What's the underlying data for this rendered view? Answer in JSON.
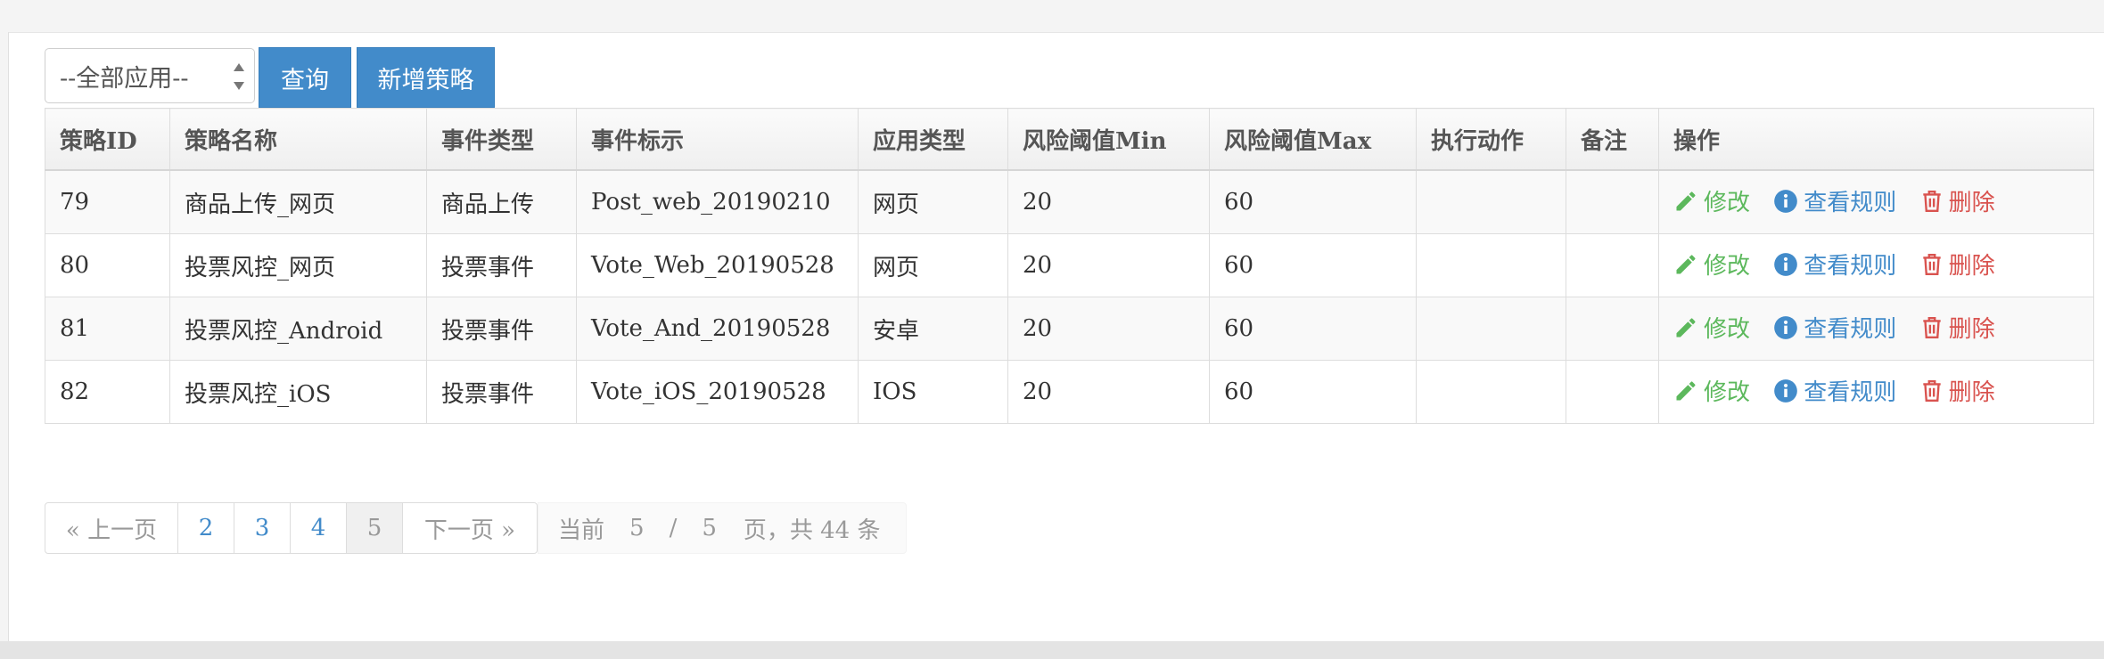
{
  "filter": {
    "app_select_value": "--全部应用--",
    "query_label": "查询",
    "add_label": "新增策略"
  },
  "table": {
    "headers": [
      "策略ID",
      "策略名称",
      "事件类型",
      "事件标示",
      "应用类型",
      "风险阈值Min",
      "风险阈值Max",
      "执行动作",
      "备注",
      "操作"
    ],
    "rows": [
      {
        "id": "79",
        "name": "商品上传_网页",
        "event_type": "商品上传",
        "event_mark": "Post_web_20190210",
        "app_type": "网页",
        "min": "20",
        "max": "60",
        "action": "",
        "remark": ""
      },
      {
        "id": "80",
        "name": "投票风控_网页",
        "event_type": "投票事件",
        "event_mark": "Vote_Web_20190528",
        "app_type": "网页",
        "min": "20",
        "max": "60",
        "action": "",
        "remark": ""
      },
      {
        "id": "81",
        "name": "投票风控_Android",
        "event_type": "投票事件",
        "event_mark": "Vote_And_20190528",
        "app_type": "安卓",
        "min": "20",
        "max": "60",
        "action": "",
        "remark": ""
      },
      {
        "id": "82",
        "name": "投票风控_iOS",
        "event_type": "投票事件",
        "event_mark": "Vote_iOS_20190528",
        "app_type": "IOS",
        "min": "20",
        "max": "60",
        "action": "",
        "remark": ""
      }
    ],
    "actions": {
      "edit": "修改",
      "view": "查看规则",
      "delete": "删除"
    }
  },
  "pagination": {
    "prev": "« 上一页",
    "pages": [
      "2",
      "3",
      "4",
      "5"
    ],
    "current": "5",
    "next": "下一页 »",
    "info_prefix": "当前",
    "info_current": "5",
    "info_sep": "/",
    "info_total": "5",
    "info_suffix": "页，共 44 条"
  },
  "colors": {
    "primary": "#428bca",
    "edit": "#5cb85c",
    "delete": "#d9534f"
  }
}
